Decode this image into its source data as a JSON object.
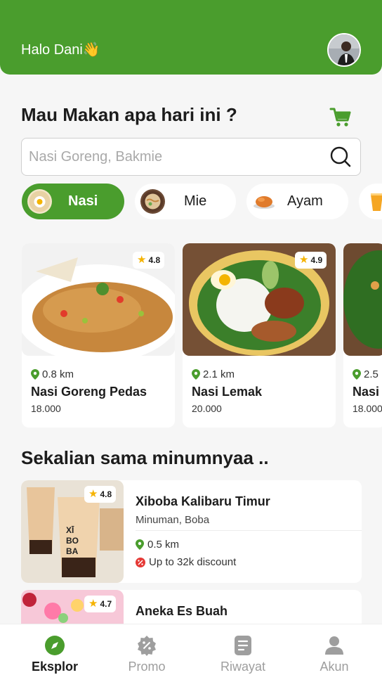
{
  "header": {
    "greeting": "Halo Dani👋"
  },
  "title": "Mau Makan apa hari ini ?",
  "search": {
    "placeholder": "Nasi Goreng, Bakmie"
  },
  "categories": [
    {
      "label": "Nasi",
      "icon": "nasi-icon",
      "active": true
    },
    {
      "label": "Mie",
      "icon": "mie-icon",
      "active": false
    },
    {
      "label": "Ayam",
      "icon": "ayam-icon",
      "active": false
    },
    {
      "label": "",
      "icon": "drink-icon",
      "active": false
    }
  ],
  "foods": [
    {
      "name": "Nasi Goreng Pedas",
      "distance": "0.8 km",
      "price": "18.000",
      "rating": "4.8"
    },
    {
      "name": "Nasi Lemak",
      "distance": "2.1 km",
      "price": "20.000",
      "rating": "4.9"
    },
    {
      "name": "Nasi",
      "distance": "2.5",
      "price": "18.000",
      "rating": ""
    }
  ],
  "section_title": "Sekalian sama minumnyaa ..",
  "drinks": [
    {
      "name": "Xiboba Kalibaru Timur",
      "category": "Minuman, Boba",
      "distance": "0.5 km",
      "discount": "Up to 32k discount",
      "rating": "4.8"
    },
    {
      "name": "Aneka Es Buah",
      "rating": "4.7"
    }
  ],
  "nav": [
    {
      "label": "Eksplor",
      "icon": "compass-icon",
      "active": true
    },
    {
      "label": "Promo",
      "icon": "promo-icon",
      "active": false
    },
    {
      "label": "Riwayat",
      "icon": "history-icon",
      "active": false
    },
    {
      "label": "Akun",
      "icon": "user-icon",
      "active": false
    }
  ],
  "colors": {
    "primary": "#4a9d2d",
    "background": "#f6f6f6",
    "star": "#f5b301",
    "discount": "#e53935"
  }
}
